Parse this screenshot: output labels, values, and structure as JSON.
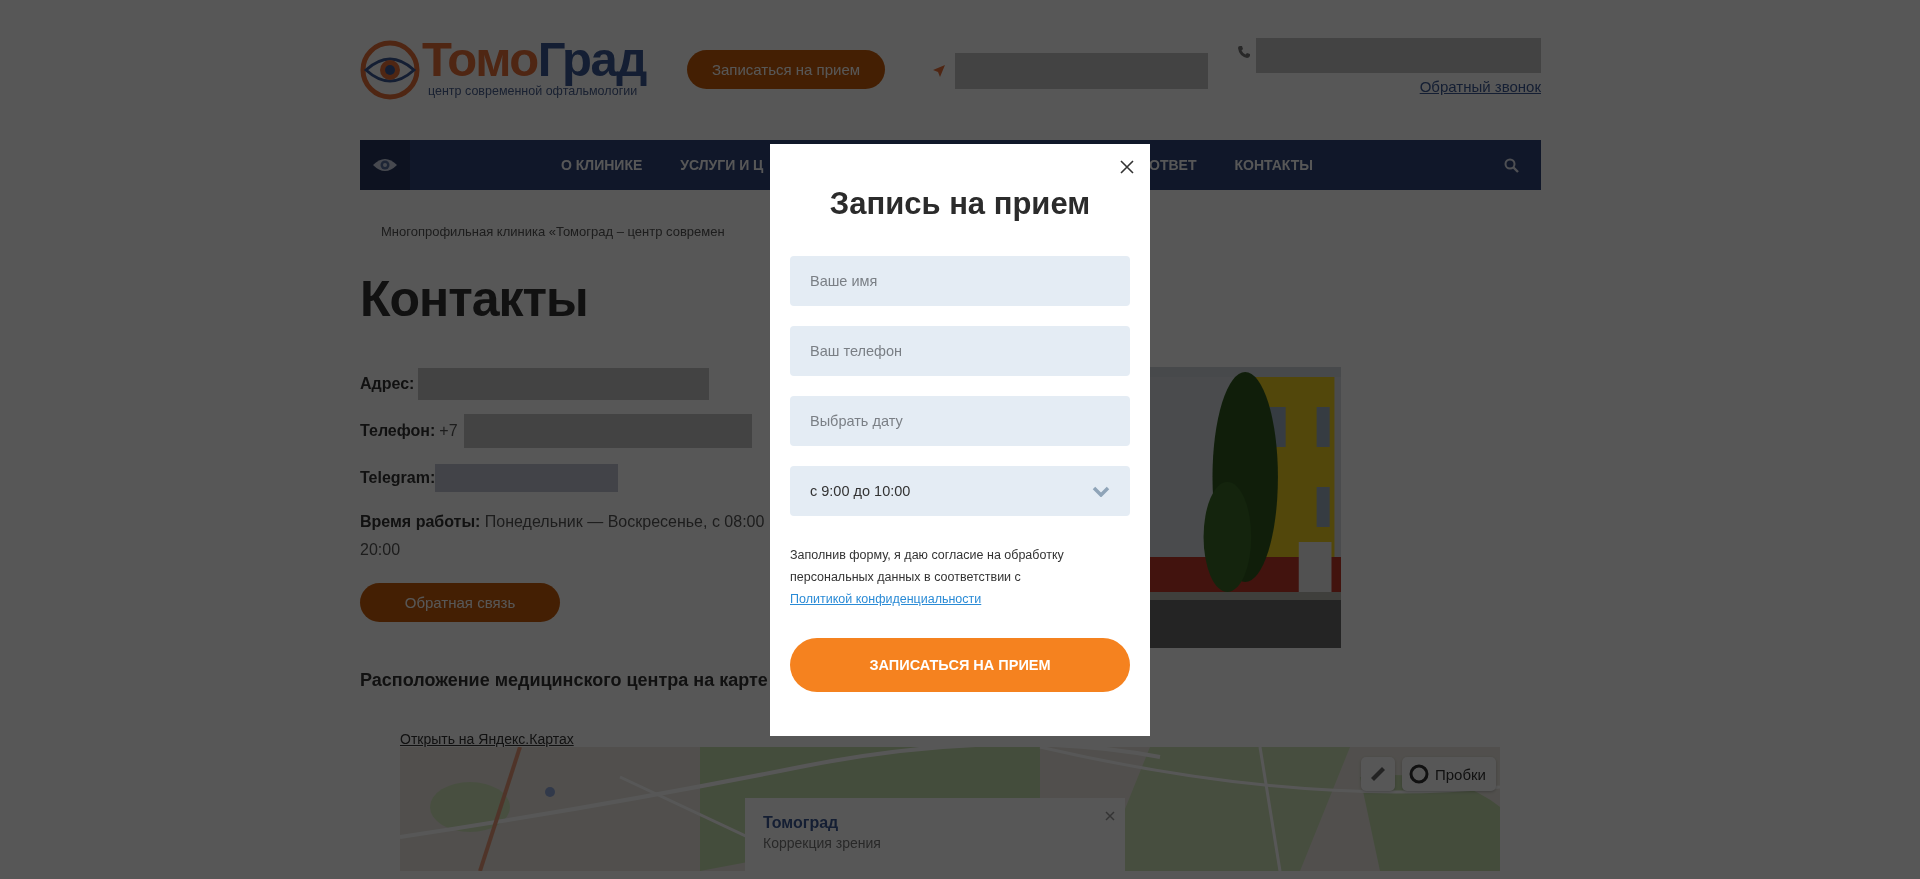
{
  "header": {
    "logo": {
      "name_parts": [
        "Томо",
        "Град"
      ],
      "tagline": "центр современной офтальмологии"
    },
    "appointment_button": "Записаться на прием",
    "callback_link": "Обратный звонок"
  },
  "nav": {
    "items": [
      {
        "label": "О КЛИНИКЕ"
      },
      {
        "label": "УСЛУГИ И Ц"
      },
      {
        "label": "ОТВЕТ"
      },
      {
        "label": "КОНТАКТЫ"
      }
    ]
  },
  "breadcrumb": "Многопрофильная клиника «Томоград – центр современ",
  "page_title": "Контакты",
  "contacts": [
    {
      "label": "Адрес:"
    },
    {
      "label": "Телефон:",
      "value": "+7"
    },
    {
      "label": "Telegram:"
    }
  ],
  "hours": {
    "line_1": "**Время работы:** Понедельник — Воскресенье, с 08:00",
    "line_2": "20:00"
  },
  "feedback_button": "Обратная связь",
  "map_section": {
    "heading": "Расположение медицинского центра на карте",
    "open_link": "Открыть на Яндекс.Картах",
    "balloon": {
      "title": "Томоград",
      "subtitle": "Коррекция зрения"
    },
    "traffic_button": "Пробки"
  },
  "modal": {
    "title": "Запись на прием",
    "fields": [
      {
        "kind": "text",
        "placeholder": "Ваше имя"
      },
      {
        "kind": "text",
        "placeholder": "Ваш телефон"
      },
      {
        "kind": "text",
        "placeholder": "Выбрать дату"
      },
      {
        "kind": "select",
        "value": "с 9:00 до 10:00"
      }
    ],
    "consent": {
      "text": "Заполнив форму, я даю согласие на обработку персональных данных в соответствии с",
      "link": "Политикой конфиденциальности"
    },
    "submit_button": "ЗАПИСАТЬСЯ НА ПРИЕМ"
  }
}
